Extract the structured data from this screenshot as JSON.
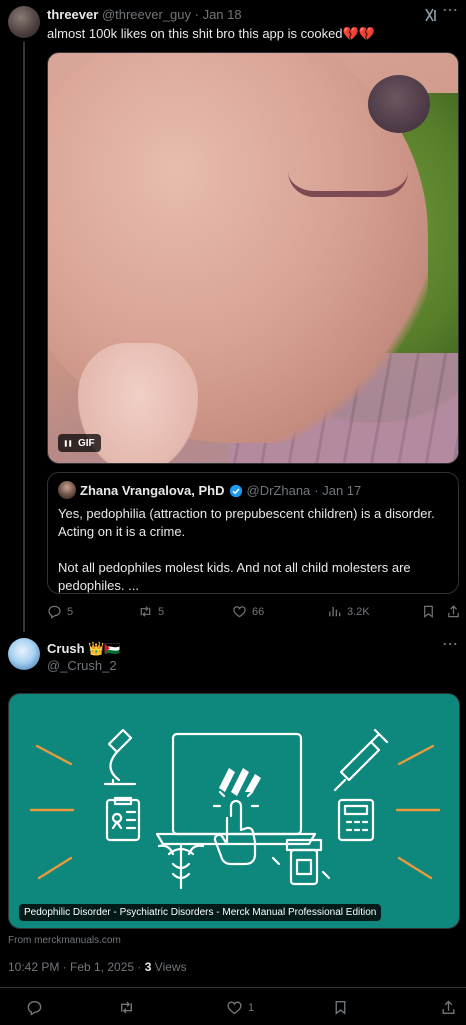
{
  "tweet1": {
    "author_name": "threever",
    "author_handle": "@threever_guy",
    "date": "· Jan 18",
    "text": "almost 100k likes on this shit bro this app is cooked",
    "emoji": "💔💔",
    "media_badge": "GIF",
    "quote": {
      "author_name": "Zhana Vrangalova, PhD",
      "author_handle": "@DrZhana",
      "date": "· Jan 17",
      "para1": "Yes, pedophilia (attraction to prepubescent children) is a disorder. Acting on it is a crime.",
      "para2": "Not all pedophiles molest kids. And not all child molesters are pedophiles. ..."
    },
    "actions": {
      "replies": "5",
      "reposts": "5",
      "likes": "66",
      "views": "3.2K"
    }
  },
  "tweet2": {
    "author_name": "Crush",
    "author_badges": "👑🇵🇸",
    "author_handle": "@_Crush_2",
    "card": {
      "caption": "Pedophilic Disorder - Psychiatric Disorders - Merck Manual Professional Edition",
      "source": "From merckmanuals.com",
      "bg_color": "#0e877c"
    },
    "time": "10:42 PM · Feb 1, 2025 ·",
    "views_count": "3",
    "views_label": "Views",
    "actions": {
      "likes": "1"
    }
  },
  "icons": [
    "grok-icon",
    "more-icon",
    "pause-icon",
    "verified-icon",
    "reply-icon",
    "repost-icon",
    "like-icon",
    "views-icon",
    "bookmark-icon",
    "share-icon"
  ]
}
